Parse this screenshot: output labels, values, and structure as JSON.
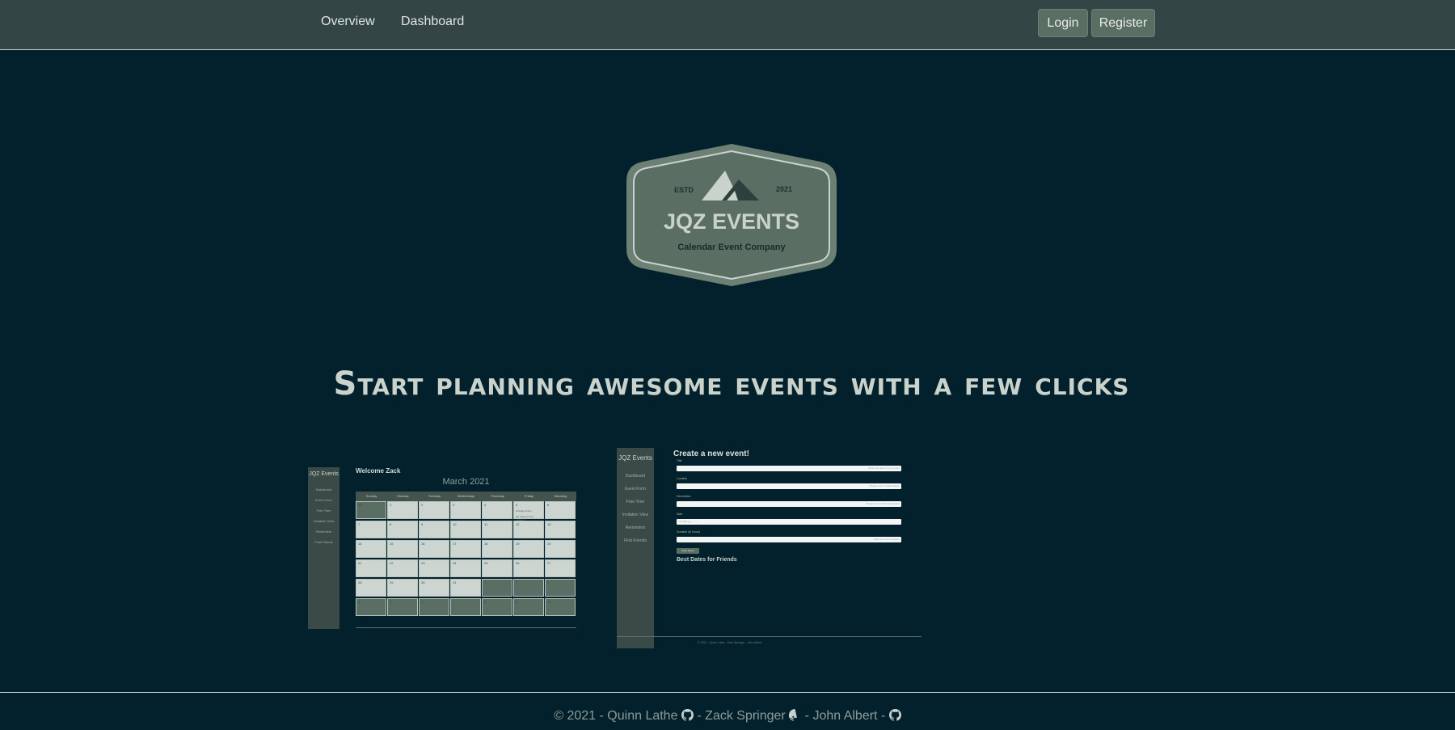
{
  "nav": {
    "links": [
      "Overview",
      "Dashboard"
    ],
    "login_label": "Login",
    "register_label": "Register"
  },
  "logo": {
    "estd": "ESTD",
    "year": "2021",
    "name": "JQZ EVENTS",
    "tagline": "Calendar Event Company"
  },
  "headline": "Start planning awesome events with a few clicks",
  "preview_calendar": {
    "brand": "JQZ Events",
    "sidebar": [
      "Dashboard",
      "Event Form",
      "Free Time",
      "Invitation View",
      "Reminders",
      "Find Friends"
    ],
    "welcome": "Welcome Zack",
    "month": "March 2021",
    "days": [
      "Sunday",
      "Monday",
      "Tuesday",
      "Wednesday",
      "Thursday",
      "Friday",
      "Saturday"
    ],
    "weeks": [
      [
        "28",
        "1",
        "2",
        "3",
        "4",
        "5",
        "6"
      ],
      [
        "7",
        "8",
        "9",
        "10",
        "11",
        "12",
        "13"
      ],
      [
        "14",
        "15",
        "16",
        "17",
        "18",
        "19",
        "20"
      ],
      [
        "21",
        "22",
        "23",
        "24",
        "25",
        "26",
        "27"
      ],
      [
        "28",
        "29",
        "30",
        "31",
        "1",
        "2",
        "3"
      ],
      [
        "4",
        "5",
        "6",
        "7",
        "8",
        "9",
        "10"
      ]
    ],
    "events": [
      "birthday dinner",
      "get ready for the weekend"
    ]
  },
  "preview_form": {
    "brand": "JQZ Events",
    "sidebar": [
      "Dashboard",
      "Event Form",
      "Free Time",
      "Invitation View",
      "Reminders",
      "Find Friends"
    ],
    "title": "Create a new event!",
    "fields": [
      {
        "label": "Title",
        "placeholder": "Enter the name of your event"
      },
      {
        "label": "Location",
        "placeholder": "Please enter a valid location"
      },
      {
        "label": "Description",
        "placeholder": "Please enter a brief description"
      },
      {
        "label": "Start",
        "placeholder": "mm/dd/yyyy --:-- --"
      },
      {
        "label": "Duration (in hours)",
        "placeholder": "Enter the event duration"
      }
    ],
    "submit": "Save Event",
    "best_dates": "Best Dates for Friends",
    "footer": "© 2021 - Quinn Lathe - Zack Springer - John Albert -"
  },
  "footer": {
    "copyright": "© 2021 - Quinn Lathe",
    "sep1": "- Zack Springer",
    "sep2": "- John Albert -"
  },
  "colors": {
    "background": "#03202d",
    "navbar": "#334544",
    "button": "#5a6e63",
    "logo_fill": "#5b6e63"
  }
}
